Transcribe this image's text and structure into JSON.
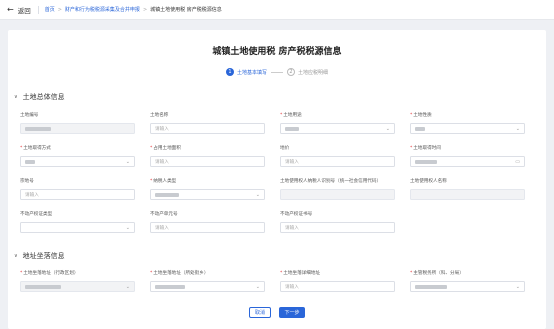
{
  "header": {
    "back_label": "返回",
    "breadcrumbs": [
      "首页",
      "财产和行为税税源采集及合并申报"
    ],
    "current": "城镇土地使用税 房产税税源信息"
  },
  "page_title": "城镇土地使用税 房产税税源信息",
  "steps": [
    {
      "num": "1",
      "label": "土地基本填写"
    },
    {
      "num": "2",
      "label": "土地应税明细"
    }
  ],
  "sections": {
    "general": "土地总体信息",
    "address": "地址坐落信息"
  },
  "fields": {
    "land_no": {
      "label": "土地编号",
      "required": false,
      "placeholder": ""
    },
    "land_name": {
      "label": "土地名称",
      "required": false,
      "placeholder": "请输入"
    },
    "land_use": {
      "label": "土地用途",
      "required": true,
      "placeholder": ""
    },
    "land_nature": {
      "label": "土地性质",
      "required": true,
      "placeholder": ""
    },
    "acquire_method": {
      "label": "土地取得方式",
      "required": true,
      "placeholder": ""
    },
    "land_area": {
      "label": "占用土地面积",
      "required": true,
      "placeholder": "请输入"
    },
    "land_price": {
      "label": "地价",
      "required": false,
      "placeholder": "请输入"
    },
    "acquire_time": {
      "label": "土地取得时间",
      "required": true,
      "placeholder": ""
    },
    "parcel_no": {
      "label": "宗地号",
      "required": false,
      "placeholder": "请输入"
    },
    "taxpayer_type": {
      "label": "纳税人类型",
      "required": true,
      "placeholder": ""
    },
    "user_id": {
      "label": "土地使用权人纳税人识别号（统一社会信用代码）",
      "required": false,
      "placeholder": ""
    },
    "user_name": {
      "label": "土地使用权人名称",
      "required": false,
      "placeholder": ""
    },
    "cert_type": {
      "label": "不动产权证类型",
      "required": false,
      "placeholder": ""
    },
    "unit_no": {
      "label": "不动产单元号",
      "required": false,
      "placeholder": "请输入"
    },
    "cert_no": {
      "label": "不动产权证书号",
      "required": false,
      "placeholder": "请输入"
    },
    "admin_area": {
      "label": "土地坐落地址（行政区划）",
      "required": true,
      "placeholder": ""
    },
    "street": {
      "label": "土地坐落地址（所处街乡）",
      "required": true,
      "placeholder": ""
    },
    "detail_addr": {
      "label": "土地坐落详细地址",
      "required": true,
      "placeholder": "请输入"
    },
    "tax_office": {
      "label": "主管税务所（科、分局）",
      "required": true,
      "placeholder": ""
    }
  },
  "buttons": {
    "cancel": "取消",
    "next": "下一步"
  },
  "colors": {
    "accent": "#2a66d9",
    "required": "#e4393c"
  }
}
